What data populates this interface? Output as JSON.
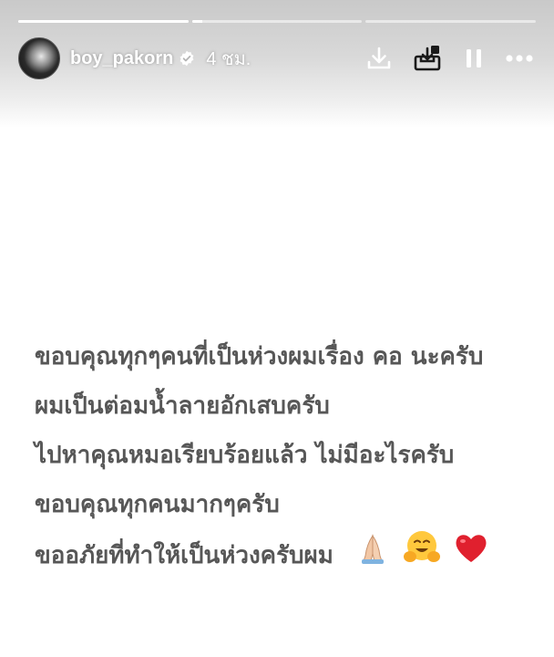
{
  "progress": {
    "segments": [
      1,
      0.06,
      0
    ]
  },
  "header": {
    "username": "boy_pakorn",
    "verified": true,
    "time": "4 ชม.",
    "actions": [
      {
        "name": "download-icon"
      },
      {
        "name": "save-to-collection-icon"
      },
      {
        "name": "pause-icon"
      },
      {
        "name": "more-icon"
      }
    ]
  },
  "story": {
    "lines": [
      "ขอบคุณทุกๆคนที่เป็นห่วงผมเรื่อง คอ นะครับ",
      "ผมเป็นต่อมน้ำลายอักเสบครับ",
      "ไปหาคุณหมอเรียบร้อยแล้ว ไม่มีอะไรครับ",
      "ขอบคุณทุกคนมากๆครับ",
      "ขออภัยที่ทำให้เป็นห่วงครับผม"
    ],
    "emojis": [
      "folded-hands-emoji",
      "hugging-face-emoji",
      "red-heart-emoji"
    ]
  },
  "colors": {
    "text": "#575757",
    "overlay_text": "#ffffff",
    "heart": "#e0202e"
  }
}
